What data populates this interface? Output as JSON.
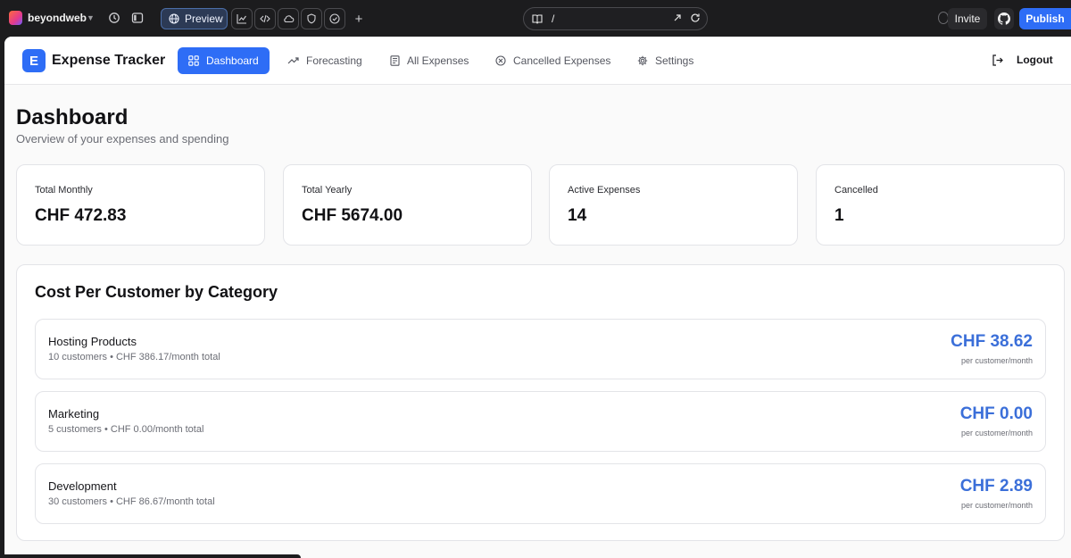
{
  "editor": {
    "project_name": "beyondweb",
    "preview_label": "Preview",
    "url_path": "/",
    "invite_label": "Invite",
    "publish_label": "Publish",
    "accent": "#2e6df6"
  },
  "app": {
    "brand_letter": "E",
    "brand_name": "Expense Tracker",
    "nav": [
      {
        "label": "Dashboard",
        "icon": "grid-icon",
        "active": true
      },
      {
        "label": "Forecasting",
        "icon": "trend-up-icon"
      },
      {
        "label": "All Expenses",
        "icon": "receipt-icon"
      },
      {
        "label": "Cancelled Expenses",
        "icon": "x-circle-icon"
      },
      {
        "label": "Settings",
        "icon": "gear-icon"
      }
    ],
    "logout_label": "Logout"
  },
  "page": {
    "title": "Dashboard",
    "subtitle": "Overview of your expenses and spending"
  },
  "stats": [
    {
      "label": "Total Monthly",
      "value": "CHF 472.83"
    },
    {
      "label": "Total Yearly",
      "value": "CHF 5674.00"
    },
    {
      "label": "Active Expenses",
      "value": "14"
    },
    {
      "label": "Cancelled",
      "value": "1"
    }
  ],
  "categories": {
    "title": "Cost Per Customer by Category",
    "unit_label": "per customer/month",
    "rows": [
      {
        "name": "Hosting Products",
        "meta": "10 customers • CHF 386.17/month total",
        "amount": "CHF 38.62"
      },
      {
        "name": "Marketing",
        "meta": "5 customers • CHF 0.00/month total",
        "amount": "CHF 0.00"
      },
      {
        "name": "Development",
        "meta": "30 customers • CHF 86.67/month total",
        "amount": "CHF 2.89"
      }
    ]
  }
}
